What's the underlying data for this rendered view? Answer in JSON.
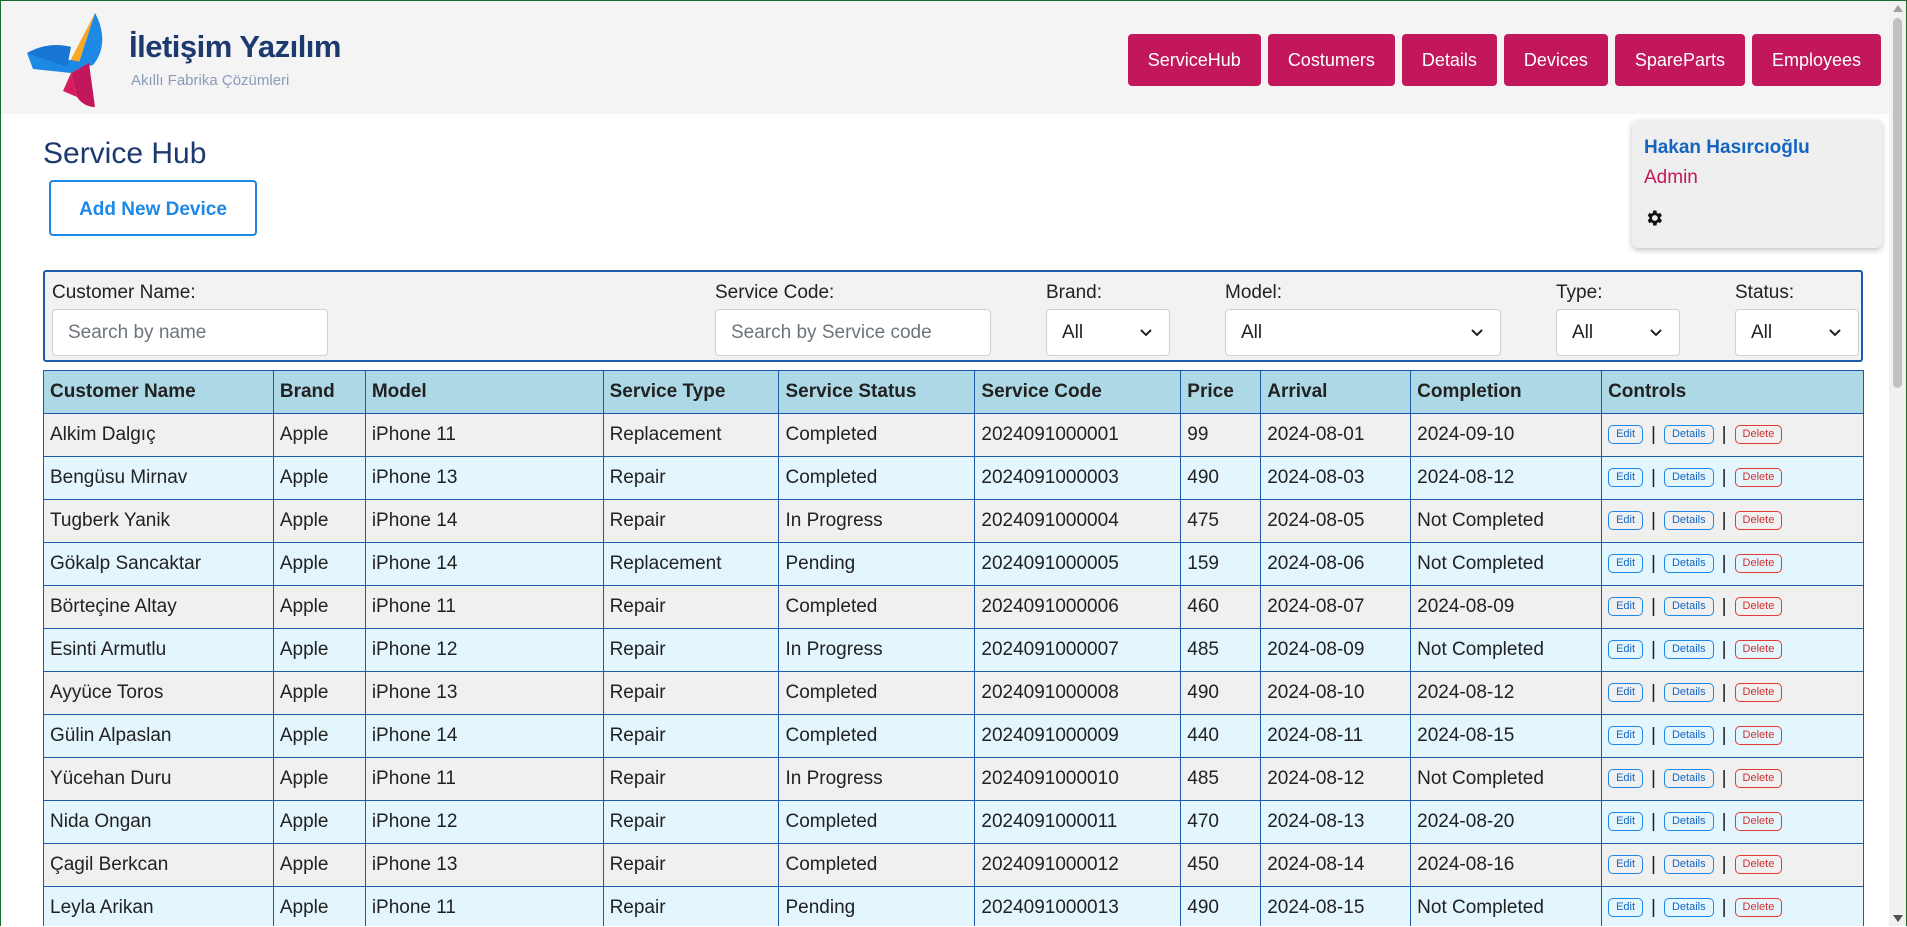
{
  "brand": {
    "title": "İletişim Yazılım",
    "subtitle": "Akıllı Fabrika Çözümleri",
    "colors": {
      "blue": "#1e88e5",
      "magenta": "#c2185b",
      "yellow": "#f9a825",
      "navy": "#1d3a6e"
    }
  },
  "nav": {
    "items": [
      "ServiceHub",
      "Costumers",
      "Details",
      "Devices",
      "SpareParts",
      "Employees"
    ]
  },
  "page": {
    "title": "Service Hub",
    "add_button": "Add New Device"
  },
  "user": {
    "name": "Hakan Hasırcıoğlu",
    "role": "Admin",
    "settings_icon": "gear-icon"
  },
  "filters": {
    "customer_label": "Customer Name:",
    "customer_placeholder": "Search by name",
    "service_label": "Service Code:",
    "service_placeholder": "Search by Service code",
    "brand_label": "Brand:",
    "brand_value": "All",
    "model_label": "Model:",
    "model_value": "All",
    "type_label": "Type:",
    "type_value": "All",
    "status_label": "Status:",
    "status_value": "All"
  },
  "table": {
    "headers": [
      "Customer Name",
      "Brand",
      "Model",
      "Service Type",
      "Service Status",
      "Service Code",
      "Price",
      "Arrival",
      "Completion",
      "Controls"
    ],
    "controls": {
      "edit": "Edit",
      "details": "Details",
      "delete": "Delete",
      "separator": "|"
    },
    "rows": [
      [
        "Alkim Dalgıç",
        "Apple",
        "iPhone 11",
        "Replacement",
        "Completed",
        "2024091000001",
        "99",
        "2024-08-01",
        "2024-09-10"
      ],
      [
        "Bengüsu Mirnav",
        "Apple",
        "iPhone 13",
        "Repair",
        "Completed",
        "2024091000003",
        "490",
        "2024-08-03",
        "2024-08-12"
      ],
      [
        "Tugberk Yanik",
        "Apple",
        "iPhone 14",
        "Repair",
        "In Progress",
        "2024091000004",
        "475",
        "2024-08-05",
        "Not Completed"
      ],
      [
        "Gökalp Sancaktar",
        "Apple",
        "iPhone 14",
        "Replacement",
        "Pending",
        "2024091000005",
        "159",
        "2024-08-06",
        "Not Completed"
      ],
      [
        "Börteçine Altay",
        "Apple",
        "iPhone 11",
        "Repair",
        "Completed",
        "2024091000006",
        "460",
        "2024-08-07",
        "2024-08-09"
      ],
      [
        "Esinti Armutlu",
        "Apple",
        "iPhone 12",
        "Repair",
        "In Progress",
        "2024091000007",
        "485",
        "2024-08-09",
        "Not Completed"
      ],
      [
        "Ayyüce Toros",
        "Apple",
        "iPhone 13",
        "Repair",
        "Completed",
        "2024091000008",
        "490",
        "2024-08-10",
        "2024-08-12"
      ],
      [
        "Gülin Alpaslan",
        "Apple",
        "iPhone 14",
        "Repair",
        "Completed",
        "2024091000009",
        "440",
        "2024-08-11",
        "2024-08-15"
      ],
      [
        "Yücehan Duru",
        "Apple",
        "iPhone 11",
        "Repair",
        "In Progress",
        "2024091000010",
        "485",
        "2024-08-12",
        "Not Completed"
      ],
      [
        "Nida Ongan",
        "Apple",
        "iPhone 12",
        "Repair",
        "Completed",
        "2024091000011",
        "470",
        "2024-08-13",
        "2024-08-20"
      ],
      [
        "Çagil Berkcan",
        "Apple",
        "iPhone 13",
        "Repair",
        "Completed",
        "2024091000012",
        "450",
        "2024-08-14",
        "2024-08-16"
      ],
      [
        "Leyla Arikan",
        "Apple",
        "iPhone 11",
        "Repair",
        "Pending",
        "2024091000013",
        "490",
        "2024-08-15",
        "Not Completed"
      ]
    ]
  }
}
